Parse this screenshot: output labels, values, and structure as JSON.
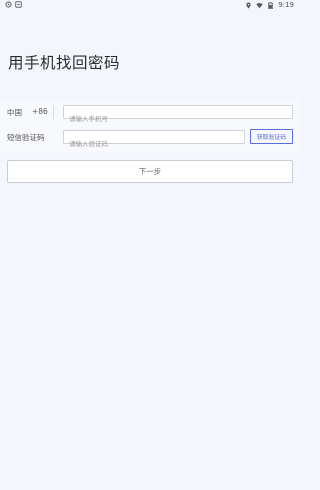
{
  "status_bar": {
    "left_icons": [
      "settings-icon",
      "notification-icon"
    ],
    "right_icons": [
      "location-icon",
      "wifi-icon",
      "battery-icon"
    ],
    "time": "9:19"
  },
  "page": {
    "title": "用手机找回密码"
  },
  "form": {
    "phone": {
      "region_label": "中国",
      "country_code": "+86",
      "placeholder": "请输入手机号",
      "value": ""
    },
    "code": {
      "label": "短信验证码",
      "placeholder": "请输入验证码",
      "value": "",
      "get_code_label": "获取验证码"
    },
    "next_label": "下一步"
  },
  "colors": {
    "background": "#f3f6fd",
    "accent": "#5c6ee0"
  }
}
